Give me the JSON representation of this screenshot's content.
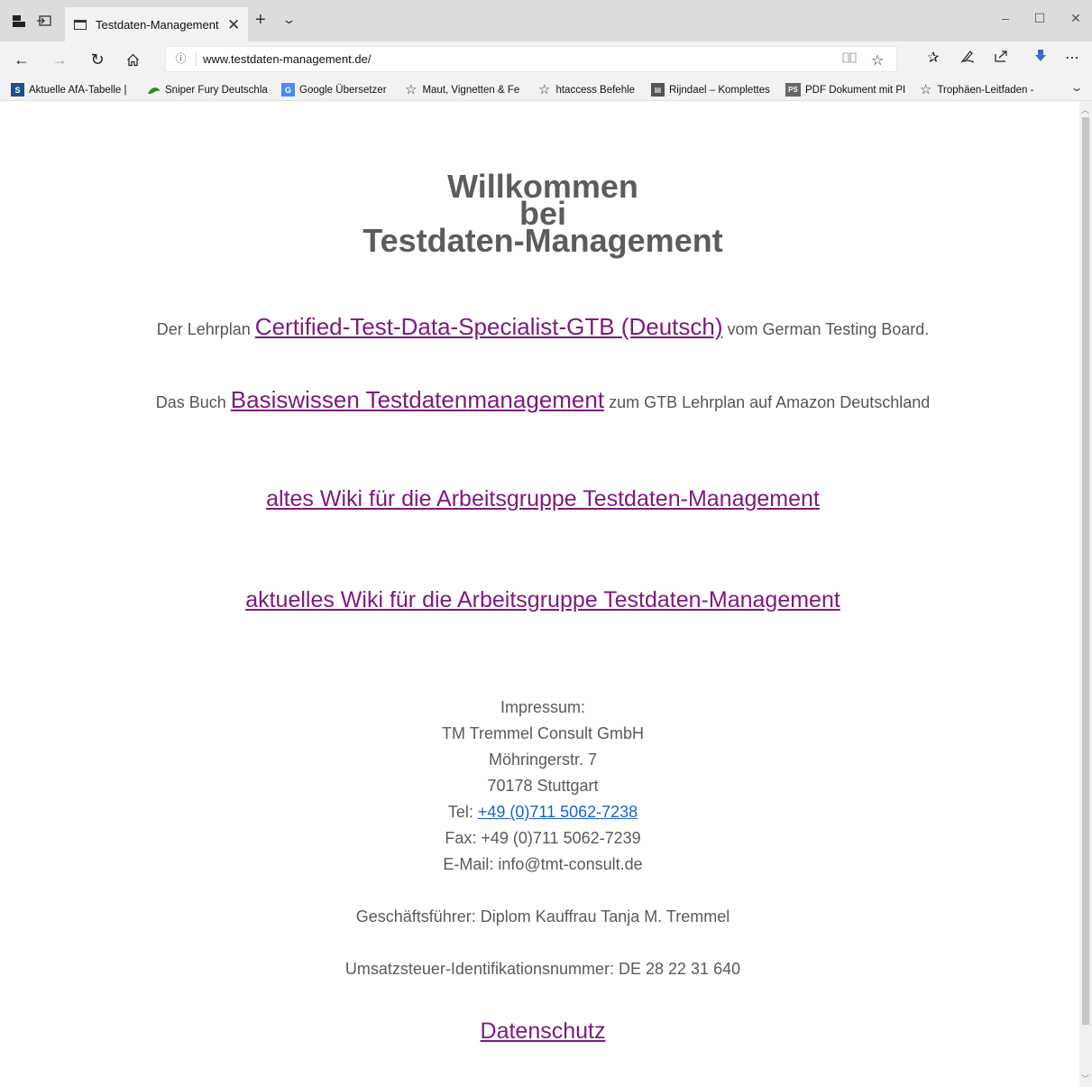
{
  "browser": {
    "tab_title": "Testdaten-Management",
    "new_tab_label": "+",
    "url": "www.testdaten-management.de/",
    "favorites": [
      {
        "label": "Aktuelle AfA-Tabelle |",
        "icon": "s-logo-icon"
      },
      {
        "label": "Sniper Fury Deutschla",
        "icon": "gecko-icon"
      },
      {
        "label": "Google Übersetzer",
        "icon": "translate-icon"
      },
      {
        "label": "Maut, Vignetten & Fe",
        "icon": "star-icon"
      },
      {
        "label": "htaccess Befehle",
        "icon": "star-icon"
      },
      {
        "label": "Rijndael – Komplettes",
        "icon": "book-icon"
      },
      {
        "label": "PDF Dokument mit PI",
        "icon": "ps-icon"
      },
      {
        "label": "Trophäen-Leitfaden -",
        "icon": "star-icon"
      }
    ]
  },
  "page": {
    "heading_line1": "Willkommen",
    "heading_line2": "bei",
    "heading_line3": "Testdaten-Management",
    "lehrplan": {
      "pre": "Der Lehrplan ",
      "link": "Certified-Test-Data-Specialist-GTB (Deutsch)",
      "post": " vom German Testing Board."
    },
    "buch": {
      "pre": "Das Buch ",
      "link": "Basiswissen Testdatenmanagement",
      "post": " zum GTB Lehrplan auf Amazon Deutschland"
    },
    "wiki_old": "altes Wiki für die Arbeitsgruppe Testdaten-Management",
    "wiki_new": "aktuelles Wiki für die Arbeitsgruppe Testdaten-Management",
    "impressum": {
      "title": "Impressum:",
      "company": "TM Tremmel Consult GmbH",
      "street": "Möhringerstr. 7",
      "city": "70178 Stuttgart",
      "tel_label": "Tel: ",
      "tel": "+49 (0)711 5062-7238",
      "fax": "Fax: +49 (0)711 5062-7239",
      "email": "E-Mail: info@tmt-consult.de",
      "ceo": "Geschäftsführer: Diplom Kauffrau Tanja M. Tremmel",
      "vat": "Umsatzsteuer-Identifikationsnummer: DE 28 22 31 640"
    },
    "datenschutz": "Datenschutz"
  },
  "colors": {
    "link_visited": "#7d1a7d",
    "link_phone": "#1a63c7",
    "text": "#5a5a5a",
    "chrome": "#f2f2f2"
  }
}
